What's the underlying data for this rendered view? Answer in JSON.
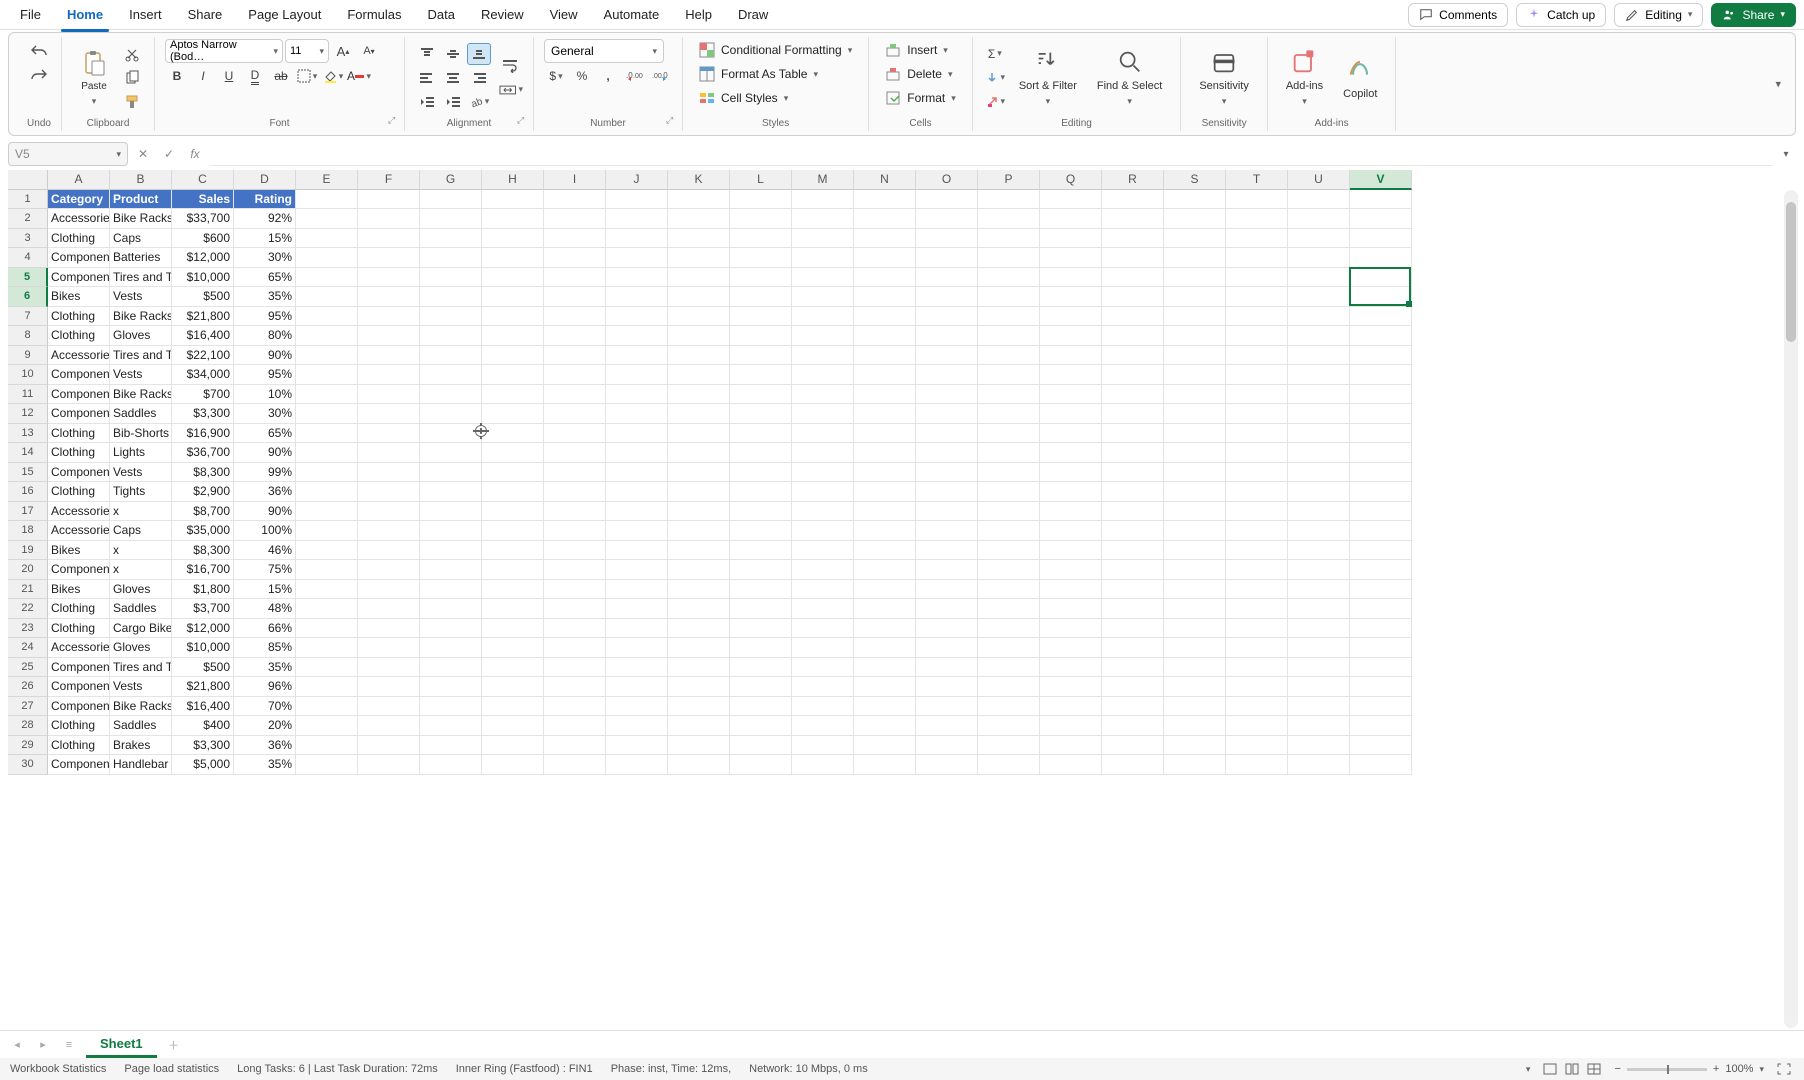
{
  "menu": {
    "items": [
      "File",
      "Home",
      "Insert",
      "Share",
      "Page Layout",
      "Formulas",
      "Data",
      "Review",
      "View",
      "Automate",
      "Help",
      "Draw"
    ],
    "active": "Home",
    "right": {
      "comments": "Comments",
      "catchup": "Catch up",
      "editing": "Editing",
      "share": "Share"
    }
  },
  "ribbon": {
    "undo_label": "Undo",
    "clipboard_label": "Clipboard",
    "paste": "Paste",
    "font_label": "Font",
    "font_name": "Aptos Narrow (Bod…",
    "font_size": "11",
    "alignment_label": "Alignment",
    "number_label": "Number",
    "number_format": "General",
    "styles_label": "Styles",
    "cond_fmt": "Conditional Formatting",
    "fmt_table": "Format As Table",
    "cell_styles": "Cell Styles",
    "cells_label": "Cells",
    "insert": "Insert",
    "delete": "Delete",
    "format": "Format",
    "editing_label": "Editing",
    "sort_filter": "Sort & Filter",
    "find_select": "Find & Select",
    "sensitivity_label": "Sensitivity",
    "sensitivity": "Sensitivity",
    "addins_label": "Add-ins",
    "addins": "Add-ins",
    "copilot": "Copilot"
  },
  "formula_bar": {
    "name_box": "V5",
    "formula": ""
  },
  "grid": {
    "columns": [
      "A",
      "B",
      "C",
      "D",
      "E",
      "F",
      "G",
      "H",
      "I",
      "J",
      "K",
      "L",
      "M",
      "N",
      "O",
      "P",
      "Q",
      "R",
      "S",
      "T",
      "U",
      "V"
    ],
    "selected_col": "V",
    "selected_rows": [
      5,
      6
    ],
    "headers": [
      "Category",
      "Product",
      "Sales",
      "Rating"
    ],
    "rows": [
      {
        "n": 2,
        "c": [
          "Accessories",
          "Bike Racks",
          "$33,700",
          "92%"
        ]
      },
      {
        "n": 3,
        "c": [
          "Clothing",
          "Caps",
          "$600",
          "15%"
        ]
      },
      {
        "n": 4,
        "c": [
          "Components",
          "Batteries",
          "$12,000",
          "30%"
        ]
      },
      {
        "n": 5,
        "c": [
          "Components",
          "Tires and T",
          "$10,000",
          "65%"
        ]
      },
      {
        "n": 6,
        "c": [
          "Bikes",
          "Vests",
          "$500",
          "35%"
        ]
      },
      {
        "n": 7,
        "c": [
          "Clothing",
          "Bike Racks",
          "$21,800",
          "95%"
        ]
      },
      {
        "n": 8,
        "c": [
          "Clothing",
          "Gloves",
          "$16,400",
          "80%"
        ]
      },
      {
        "n": 9,
        "c": [
          "Accessories",
          "Tires and T",
          "$22,100",
          "90%"
        ]
      },
      {
        "n": 10,
        "c": [
          "Components",
          "Vests",
          "$34,000",
          "95%"
        ]
      },
      {
        "n": 11,
        "c": [
          "Components",
          "Bike Racks",
          "$700",
          "10%"
        ]
      },
      {
        "n": 12,
        "c": [
          "Components",
          "Saddles",
          "$3,300",
          "30%"
        ]
      },
      {
        "n": 13,
        "c": [
          "Clothing",
          "Bib-Shorts",
          "$16,900",
          "65%"
        ]
      },
      {
        "n": 14,
        "c": [
          "Clothing",
          "Lights",
          "$36,700",
          "90%"
        ]
      },
      {
        "n": 15,
        "c": [
          "Components",
          "Vests",
          "$8,300",
          "99%"
        ]
      },
      {
        "n": 16,
        "c": [
          "Clothing",
          "Tights",
          "$2,900",
          "36%"
        ]
      },
      {
        "n": 17,
        "c": [
          "Accessories",
          "x",
          "$8,700",
          "90%"
        ]
      },
      {
        "n": 18,
        "c": [
          "Accessories",
          "Caps",
          "$35,000",
          "100%"
        ]
      },
      {
        "n": 19,
        "c": [
          "Bikes",
          "x",
          "$8,300",
          "46%"
        ]
      },
      {
        "n": 20,
        "c": [
          "Components",
          "x",
          "$16,700",
          "75%"
        ]
      },
      {
        "n": 21,
        "c": [
          "Bikes",
          "Gloves",
          "$1,800",
          "15%"
        ]
      },
      {
        "n": 22,
        "c": [
          "Clothing",
          "Saddles",
          "$3,700",
          "48%"
        ]
      },
      {
        "n": 23,
        "c": [
          "Clothing",
          "Cargo Bike",
          "$12,000",
          "66%"
        ]
      },
      {
        "n": 24,
        "c": [
          "Accessories",
          "Gloves",
          "$10,000",
          "85%"
        ]
      },
      {
        "n": 25,
        "c": [
          "Components",
          "Tires and T",
          "$500",
          "35%"
        ]
      },
      {
        "n": 26,
        "c": [
          "Components",
          "Vests",
          "$21,800",
          "96%"
        ]
      },
      {
        "n": 27,
        "c": [
          "Components",
          "Bike Racks",
          "$16,400",
          "70%"
        ]
      },
      {
        "n": 28,
        "c": [
          "Clothing",
          "Saddles",
          "$400",
          "20%"
        ]
      },
      {
        "n": 29,
        "c": [
          "Clothing",
          "Brakes",
          "$3,300",
          "36%"
        ]
      },
      {
        "n": 30,
        "c": [
          "Components",
          "Handlebar",
          "$5,000",
          "35%"
        ]
      }
    ]
  },
  "sheets": {
    "active": "Sheet1"
  },
  "status": {
    "workbook_stats": "Workbook Statistics",
    "page_load": "Page load statistics",
    "long_tasks": "Long Tasks: 6 | Last Task Duration: 72ms",
    "inner_ring": "Inner Ring (Fastfood) : FIN1",
    "phase": "Phase: inst, Time: 12ms,",
    "network": "Network: 10 Mbps, 0 ms",
    "zoom": "100%"
  }
}
